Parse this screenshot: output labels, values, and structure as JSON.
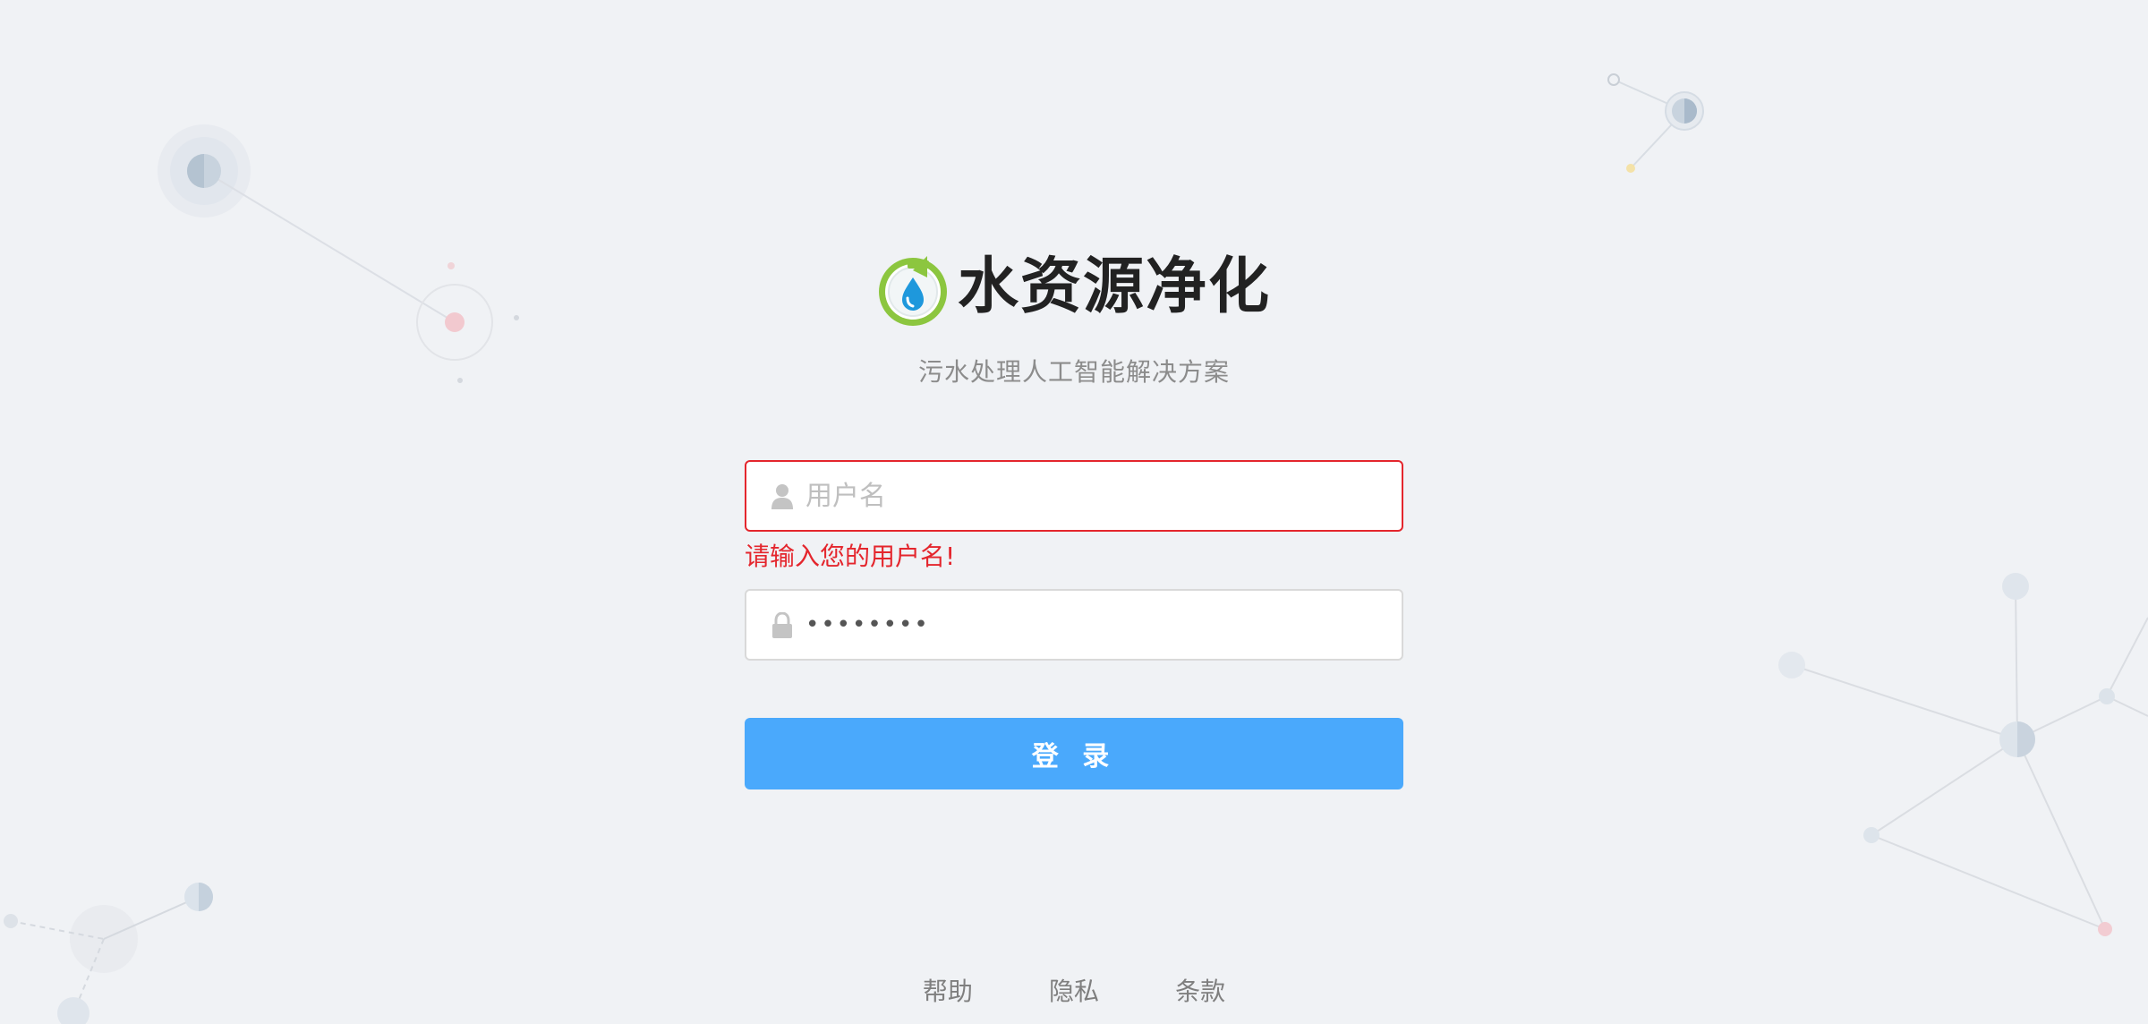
{
  "header": {
    "title": "水资源净化",
    "subtitle": "污水处理人工智能解决方案",
    "logo_icon": "water-drop-recycle-logo"
  },
  "login_form": {
    "username": {
      "placeholder": "用户名",
      "value": "",
      "icon": "user-icon",
      "error": "请输入您的用户名!"
    },
    "password": {
      "value": "••••••••",
      "icon": "lock-icon"
    },
    "submit_label": "登 录"
  },
  "footer": {
    "links": [
      "帮助",
      "隐私",
      "条款"
    ]
  },
  "colors": {
    "primary": "#4aa9fc",
    "error": "#e4262d",
    "background": "#f0f2f5"
  }
}
